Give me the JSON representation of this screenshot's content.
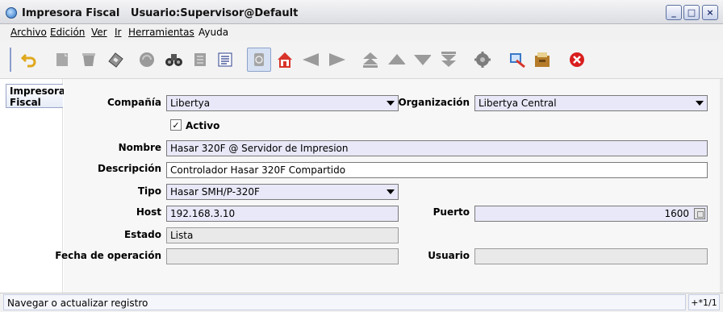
{
  "window": {
    "title": "Impresora Fiscal   Usuario:Supervisor@Default",
    "controls": {
      "minimize": "_",
      "maximize": "□",
      "close": "×"
    }
  },
  "menu": [
    {
      "label": "Archivo",
      "mnemonic_index": 0
    },
    {
      "label": "Edición",
      "mnemonic_index": 0
    },
    {
      "label": "Ver",
      "mnemonic_index": 0
    },
    {
      "label": "Ir",
      "mnemonic_index": 0
    },
    {
      "label": "Herramientas",
      "mnemonic_index": 0
    },
    {
      "label": "Ayuda",
      "mnemonic_index": -1
    }
  ],
  "toolbar": {
    "icons": [
      "undo-icon",
      "new-icon",
      "delete-icon",
      "save-icon",
      "refresh-icon",
      "find-icon",
      "history-icon",
      "grid-toggle-icon",
      "attachment-icon",
      "home-icon",
      "previous-record-icon",
      "next-record-icon",
      "first-record-icon",
      "previous-icon",
      "next-icon",
      "last-record-icon",
      "report-icon",
      "archive-icon",
      "zoom-across-icon",
      "close-window-icon"
    ],
    "colors": {
      "undo": "#e0a81e",
      "home": "#d8342a",
      "nav": "#9a9a9a",
      "close": "#d91e1e"
    }
  },
  "side_tab": {
    "label": "Impresora Fiscal"
  },
  "form": {
    "compania": {
      "label": "Compañía",
      "value": "Libertya"
    },
    "organizacion": {
      "label": "Organización",
      "value": "Libertya Central"
    },
    "activo": {
      "label": "Activo",
      "checked": true,
      "mark": "✓"
    },
    "nombre": {
      "label": "Nombre",
      "value": "Hasar 320F @ Servidor de Impresion"
    },
    "descripcion": {
      "label": "Descripción",
      "value": "Controlador Hasar 320F Compartido"
    },
    "tipo": {
      "label": "Tipo",
      "value": "Hasar SMH/P-320F"
    },
    "host": {
      "label": "Host",
      "value": "192.168.3.10"
    },
    "puerto": {
      "label": "Puerto",
      "value": "1600"
    },
    "estado": {
      "label": "Estado",
      "value": "Lista"
    },
    "fecha_operacion": {
      "label": "Fecha de operación",
      "value": ""
    },
    "usuario": {
      "label": "Usuario",
      "value": ""
    }
  },
  "status": {
    "message": "Navegar o actualizar registro",
    "record": "+*1/1"
  },
  "colors": {
    "mandatory_field": "#e8e8f8",
    "readonly_field": "#e9e9e9",
    "form_bg": "#f7f7f7"
  }
}
